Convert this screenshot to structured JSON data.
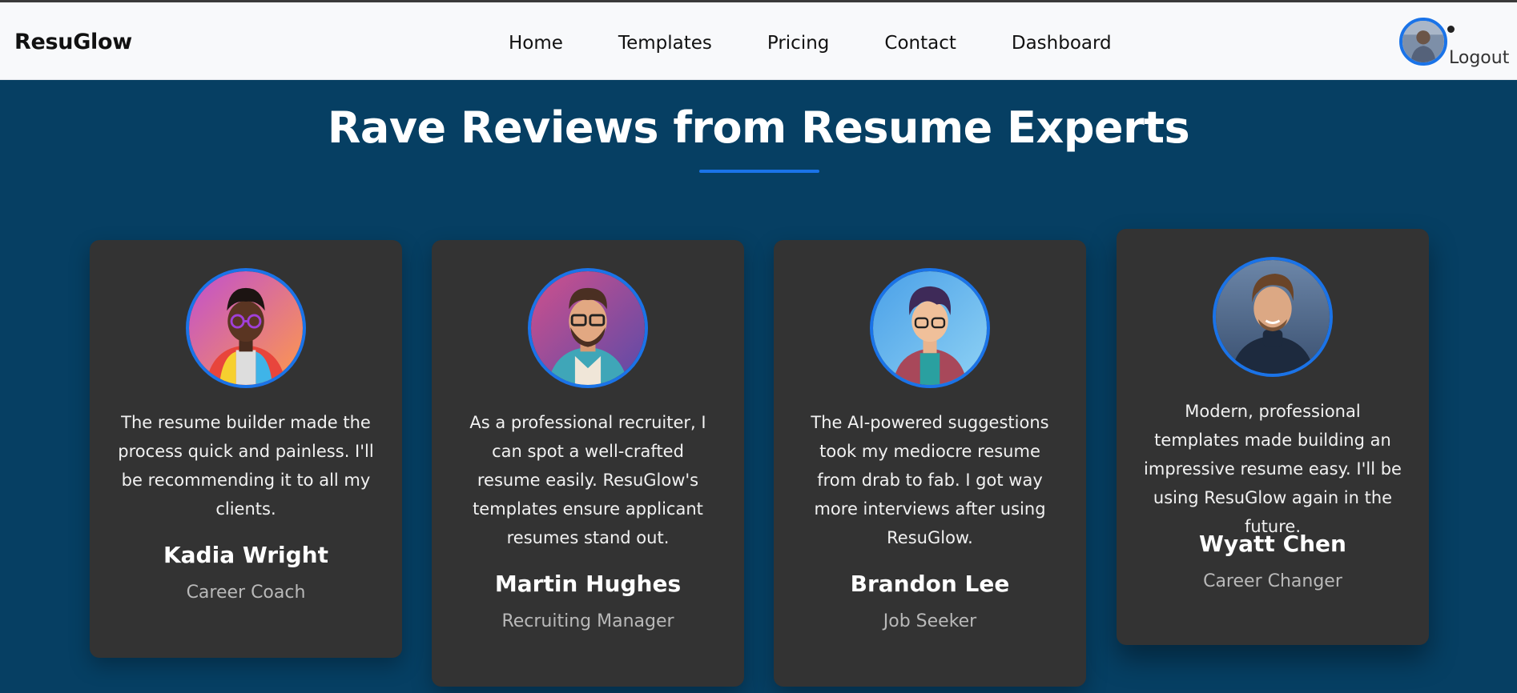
{
  "header": {
    "brand": "ResuGlow",
    "nav": [
      "Home",
      "Templates",
      "Pricing",
      "Contact",
      "Dashboard"
    ],
    "logout_label": "Logout"
  },
  "section": {
    "title": "Rave Reviews from Resume Experts"
  },
  "testimonials": [
    {
      "quote": "The resume builder made the process quick and painless. I'll be recommending it to all my clients.",
      "name": "Kadia Wright",
      "role": "Career Coach"
    },
    {
      "quote": "As a professional recruiter, I can spot a well-crafted resume easily. ResuGlow's templates ensure applicant resumes stand out.",
      "name": "Martin Hughes",
      "role": "Recruiting Manager"
    },
    {
      "quote": "The AI-powered suggestions took my mediocre resume from drab to fab. I got way more interviews after using ResuGlow.",
      "name": "Brandon Lee",
      "role": "Job Seeker"
    },
    {
      "quote": "Modern, professional templates made building an impressive resume easy. I'll be using ResuGlow again in the future.",
      "name": "Wyatt Chen",
      "role": "Career Changer"
    }
  ],
  "colors": {
    "accent": "#1a73e8",
    "section_bg": "#063f63",
    "card_bg": "#333333",
    "navbar_bg": "#f8f9fb"
  }
}
